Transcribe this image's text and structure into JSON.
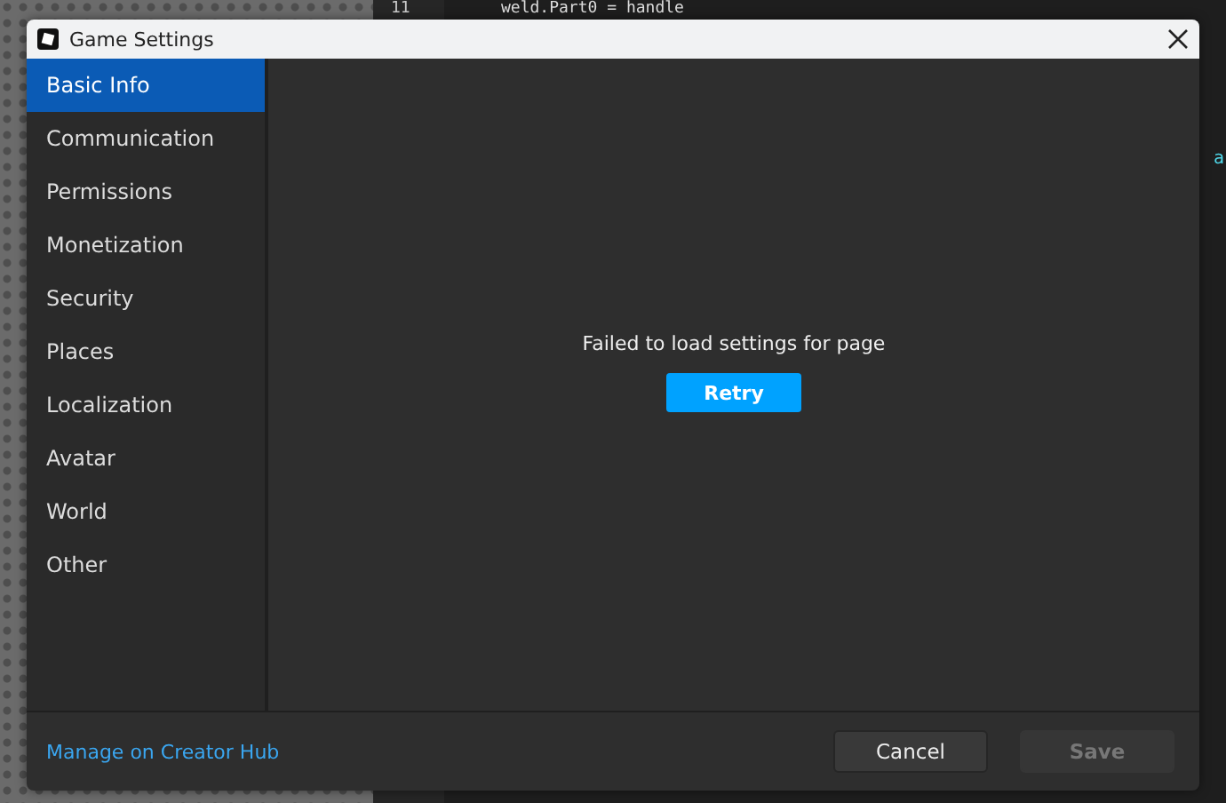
{
  "editor": {
    "line_number": "11",
    "code": "weld.Part0 = handle",
    "edge_text": "a"
  },
  "window": {
    "title": "Game Settings"
  },
  "sidebar": {
    "items": [
      {
        "label": "Basic Info",
        "selected": true
      },
      {
        "label": "Communication",
        "selected": false
      },
      {
        "label": "Permissions",
        "selected": false
      },
      {
        "label": "Monetization",
        "selected": false
      },
      {
        "label": "Security",
        "selected": false
      },
      {
        "label": "Places",
        "selected": false
      },
      {
        "label": "Localization",
        "selected": false
      },
      {
        "label": "Avatar",
        "selected": false
      },
      {
        "label": "World",
        "selected": false
      },
      {
        "label": "Other",
        "selected": false
      }
    ]
  },
  "content": {
    "message": "Failed to load settings for page",
    "retry_button": "Retry"
  },
  "footer": {
    "link": "Manage on Creator Hub",
    "buttons": [
      {
        "label": "Cancel",
        "disabled": false
      },
      {
        "label": "Save",
        "disabled": true
      }
    ]
  }
}
